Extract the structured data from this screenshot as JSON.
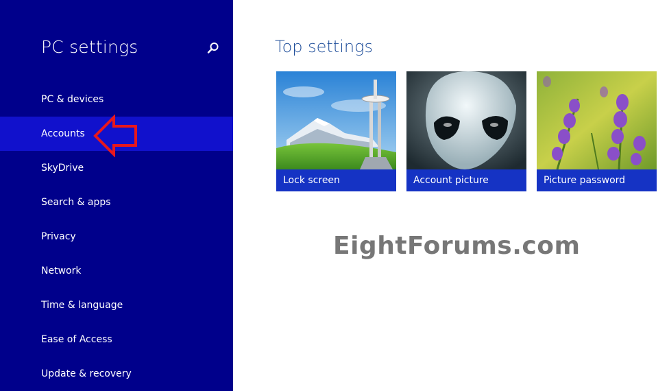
{
  "sidebar": {
    "title": "PC settings",
    "search_icon": "search-icon",
    "items": [
      {
        "label": "PC & devices"
      },
      {
        "label": "Accounts"
      },
      {
        "label": "SkyDrive"
      },
      {
        "label": "Search & apps"
      },
      {
        "label": "Privacy"
      },
      {
        "label": "Network"
      },
      {
        "label": "Time & language"
      },
      {
        "label": "Ease of Access"
      },
      {
        "label": "Update & recovery"
      }
    ],
    "selected_index": 1
  },
  "main": {
    "title": "Top settings",
    "tiles": [
      {
        "label": "Lock screen"
      },
      {
        "label": "Account picture"
      },
      {
        "label": "Picture password"
      }
    ]
  },
  "watermark": "EightForums.com",
  "colors": {
    "sidebar_bg": "#00008b",
    "selected_bg": "#1111cc",
    "tile_label_bg": "#1533c4",
    "title_text": "#1f4e9a",
    "arrow": "#e8171d"
  }
}
